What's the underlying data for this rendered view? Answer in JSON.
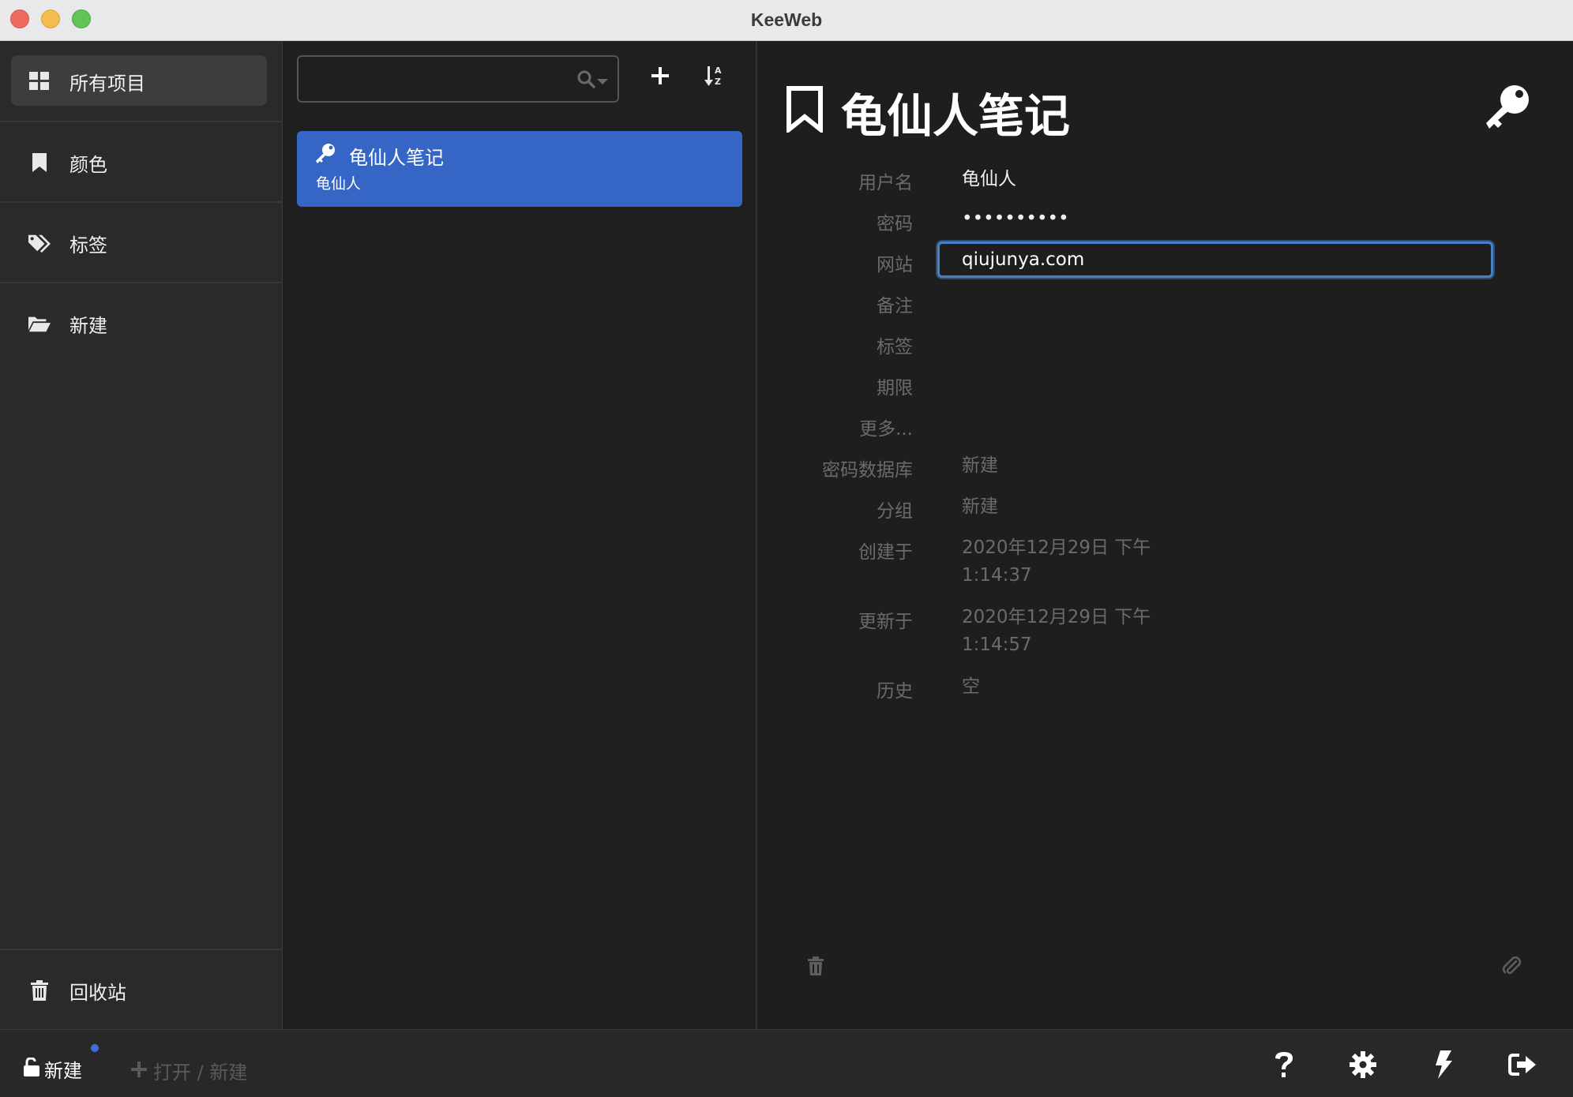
{
  "window": {
    "title": "KeeWeb"
  },
  "sidebar": {
    "items": [
      {
        "label": "所有项目",
        "icon": "grid-icon"
      },
      {
        "label": "颜色",
        "icon": "bookmark-icon"
      },
      {
        "label": "标签",
        "icon": "tags-icon"
      },
      {
        "label": "新建",
        "icon": "folder-open-icon"
      }
    ],
    "trash": {
      "label": "回收站",
      "icon": "trash-icon"
    }
  },
  "list": {
    "search": {
      "value": "",
      "placeholder": ""
    },
    "entries": [
      {
        "title": "龟仙人笔记",
        "subtitle": "龟仙人",
        "icon": "key-icon"
      }
    ]
  },
  "details": {
    "title": "龟仙人笔记",
    "fields": {
      "username": {
        "label": "用户名",
        "value": "龟仙人"
      },
      "password": {
        "label": "密码",
        "value": "••••••••••"
      },
      "website": {
        "label": "网站",
        "value": "qiujunya.com"
      },
      "notes": {
        "label": "备注"
      },
      "tags": {
        "label": "标签"
      },
      "expires": {
        "label": "期限"
      },
      "more": {
        "label": "更多..."
      },
      "database": {
        "label": "密码数据库",
        "value": "新建"
      },
      "group": {
        "label": "分组",
        "value": "新建"
      },
      "created": {
        "label": "创建于",
        "line1": "2020年12月29日 下午",
        "line2": "1:14:37"
      },
      "updated": {
        "label": "更新于",
        "line1": "2020年12月29日 下午",
        "line2": "1:14:57"
      },
      "history": {
        "label": "历史",
        "value": "空"
      }
    }
  },
  "footer": {
    "db_label": "新建",
    "open_label": "打开 / 新建"
  },
  "colors": {
    "accent": "#3565c5",
    "focus_ring": "#4a7fc1",
    "unsaved_dot": "#3c6fe0"
  }
}
